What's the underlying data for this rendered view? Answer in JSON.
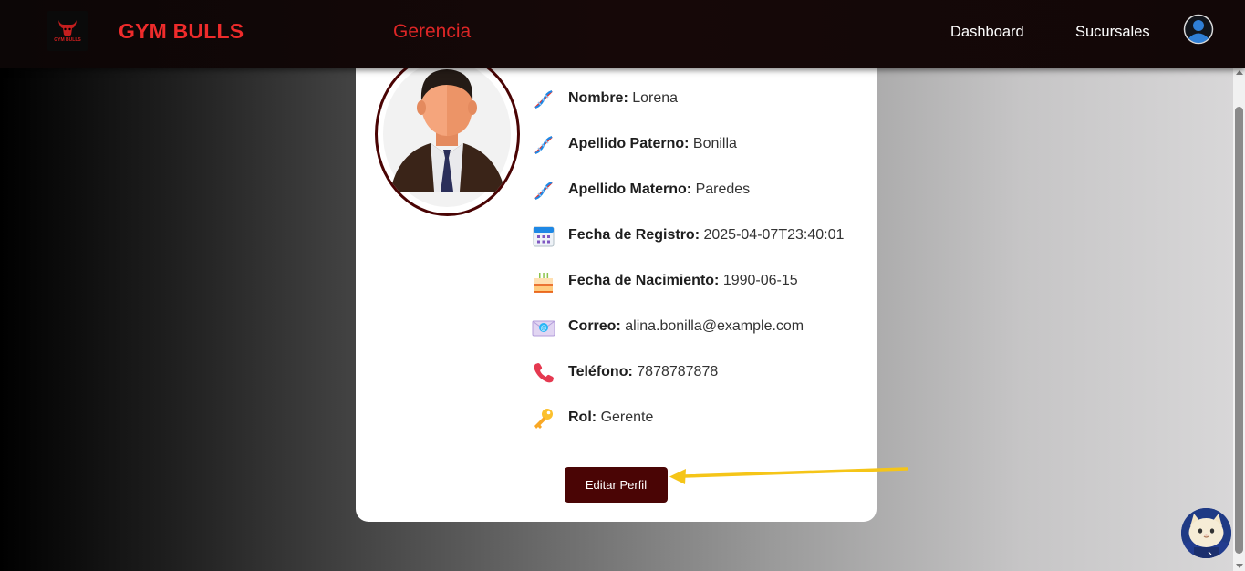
{
  "navbar": {
    "brand": "GYM BULLS",
    "logo_text": "GYM BULLS",
    "section_title": "Gerencia",
    "links": [
      {
        "label": "Dashboard"
      },
      {
        "label": "Sucursales"
      }
    ],
    "profile_icon": "user-circle-icon"
  },
  "profile": {
    "photo_icon": "businessman-avatar",
    "fields": [
      {
        "icon": "dna-icon",
        "label": "Nombre:",
        "value": "Lorena"
      },
      {
        "icon": "dna-icon",
        "label": "Apellido Paterno:",
        "value": "Bonilla"
      },
      {
        "icon": "dna-icon",
        "label": "Apellido Materno:",
        "value": "Paredes"
      },
      {
        "icon": "calendar-icon",
        "label": "Fecha de Registro:",
        "value": "2025-04-07T23:40:01"
      },
      {
        "icon": "cake-icon",
        "label": "Fecha de Nacimiento:",
        "value": "1990-06-15"
      },
      {
        "icon": "email-icon",
        "label": "Correo:",
        "value": "alina.bonilla@example.com"
      },
      {
        "icon": "phone-icon",
        "label": "Teléfono:",
        "value": "7878787878"
      },
      {
        "icon": "key-icon",
        "label": "Rol:",
        "value": "Gerente"
      }
    ],
    "edit_button": "Editar Perfil"
  },
  "colors": {
    "brand_red": "#ee2b2b",
    "button_maroon": "#4a0505",
    "arrow_yellow": "#f5c518"
  }
}
